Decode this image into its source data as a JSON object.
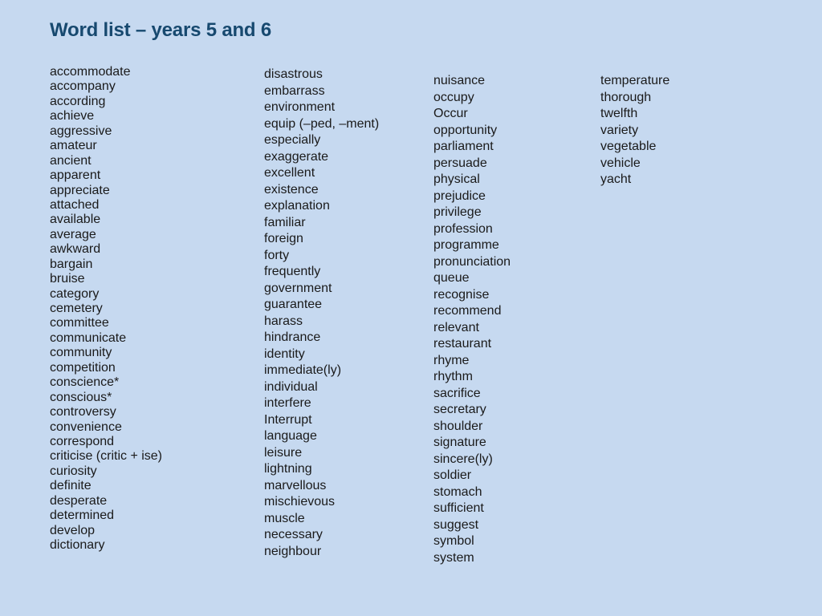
{
  "title": "Word list – years 5 and 6",
  "columns": [
    [
      "accommodate",
      "accompany",
      "according",
      "achieve",
      "aggressive",
      "amateur",
      "ancient",
      "apparent",
      "appreciate",
      "attached",
      "available",
      "average",
      "awkward",
      "bargain",
      "bruise",
      "category",
      "cemetery",
      "committee",
      "communicate",
      "community",
      "competition",
      "conscience*",
      "conscious*",
      "controversy",
      "convenience",
      "correspond",
      "criticise (critic + ise)",
      "curiosity",
      "definite",
      "desperate",
      "determined",
      "develop",
      "dictionary"
    ],
    [
      "disastrous",
      "embarrass",
      "environment",
      "equip (–ped, –ment)",
      "especially",
      "exaggerate",
      "excellent",
      "existence",
      "explanation",
      "familiar",
      "foreign",
      "forty",
      "frequently",
      "government",
      "guarantee",
      "harass",
      "hindrance",
      "identity",
      "immediate(ly)",
      "individual",
      "interfere",
      "Interrupt",
      "language",
      "leisure",
      "lightning",
      "marvellous",
      "mischievous",
      "muscle",
      "necessary",
      "neighbour"
    ],
    [
      "nuisance",
      "occupy",
      "Occur",
      "opportunity",
      "parliament",
      "persuade",
      "physical",
      "prejudice",
      "privilege",
      "profession",
      "programme",
      "pronunciation",
      "queue",
      "recognise",
      "recommend",
      "relevant",
      "restaurant",
      "rhyme",
      "rhythm",
      "sacrifice",
      "secretary",
      "shoulder",
      "signature",
      "sincere(ly)",
      "soldier",
      "stomach",
      "sufficient",
      "suggest",
      "symbol",
      "system"
    ],
    [
      "temperature",
      "thorough",
      "twelfth",
      "variety",
      "vegetable",
      "vehicle",
      "yacht"
    ]
  ]
}
